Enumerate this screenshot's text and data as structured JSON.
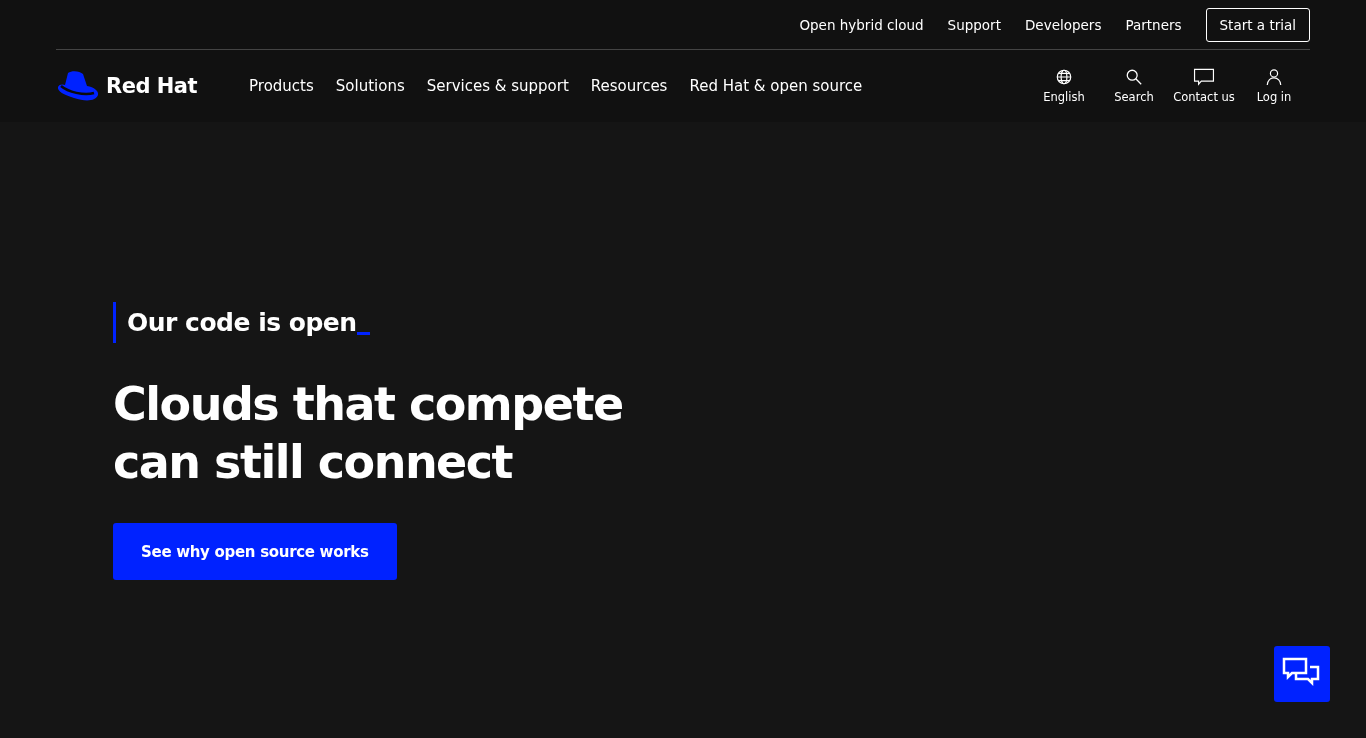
{
  "top_links": [
    "Open hybrid cloud",
    "Support",
    "Developers",
    "Partners"
  ],
  "trial_button": "Start a trial",
  "logo": "Red Hat",
  "nav": [
    "Products",
    "Solutions",
    "Services & support",
    "Resources",
    "Red Hat & open source"
  ],
  "utilities": [
    {
      "kind": "globe",
      "label": "English"
    },
    {
      "kind": "search",
      "label": "Search"
    },
    {
      "kind": "chat",
      "label": "Contact us"
    },
    {
      "kind": "user",
      "label": "Log in"
    }
  ],
  "hero": {
    "eyebrow": "Our code is open",
    "headline_lines": [
      "Clouds that compete",
      "can still connect"
    ],
    "cta": "See why open source works"
  }
}
